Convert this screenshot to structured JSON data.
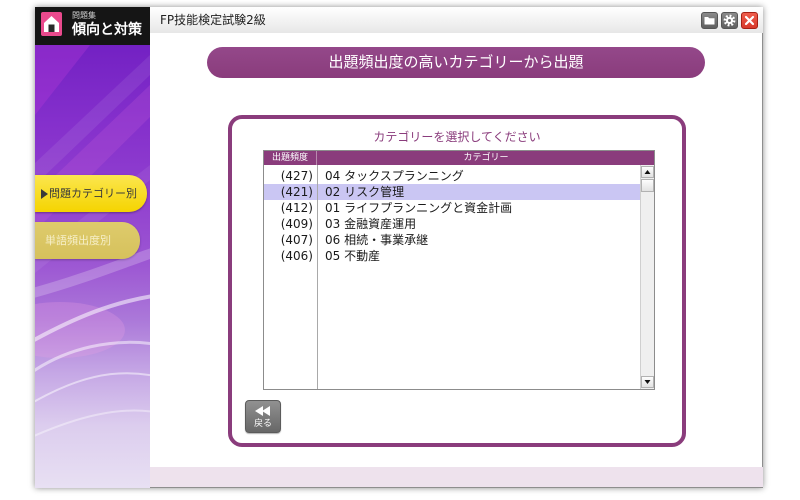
{
  "app": {
    "logo_caption": "問題集",
    "logo_title": "傾向と対策",
    "logo_icon": "home-icon",
    "window_title": "FP技能検定試験2級"
  },
  "toolbar": {
    "icons": [
      "folder-icon",
      "gear-icon",
      "close-icon"
    ]
  },
  "sidebar": {
    "items": [
      {
        "label": "問題カテゴリー別",
        "marker_icon": "triangle-right-icon",
        "active": true
      },
      {
        "label": "単語頻出度別",
        "active": false
      }
    ]
  },
  "banner": {
    "text": "出題頻出度の高いカテゴリーから出題"
  },
  "category_panel": {
    "prompt": "カテゴリーを選択してください",
    "columns": {
      "frequency": "出題頻度",
      "category": "カテゴリー"
    },
    "rows": [
      {
        "count": "(427)",
        "category": "04 タックスプランニング"
      },
      {
        "count": "(421)",
        "category": "02 リスク管理"
      },
      {
        "count": "(412)",
        "category": "01 ライフプランニングと資金計画"
      },
      {
        "count": "(409)",
        "category": "03 金融資産運用"
      },
      {
        "count": "(407)",
        "category": "06 相続・事業承継"
      },
      {
        "count": "(406)",
        "category": "05 不動産"
      }
    ],
    "selected_index": 1,
    "scroll_icons": [
      "triangle-up-icon",
      "triangle-down-icon"
    ]
  },
  "back_button": {
    "icon": "rewind-icon",
    "label": "戻る"
  },
  "colors": {
    "accent": "#8a3c7c",
    "selected_row": "#cac6f3",
    "sidebar_active": "#f5d400",
    "sidebar_inactive": "#d6c15c",
    "close_button": "#d8392b"
  }
}
